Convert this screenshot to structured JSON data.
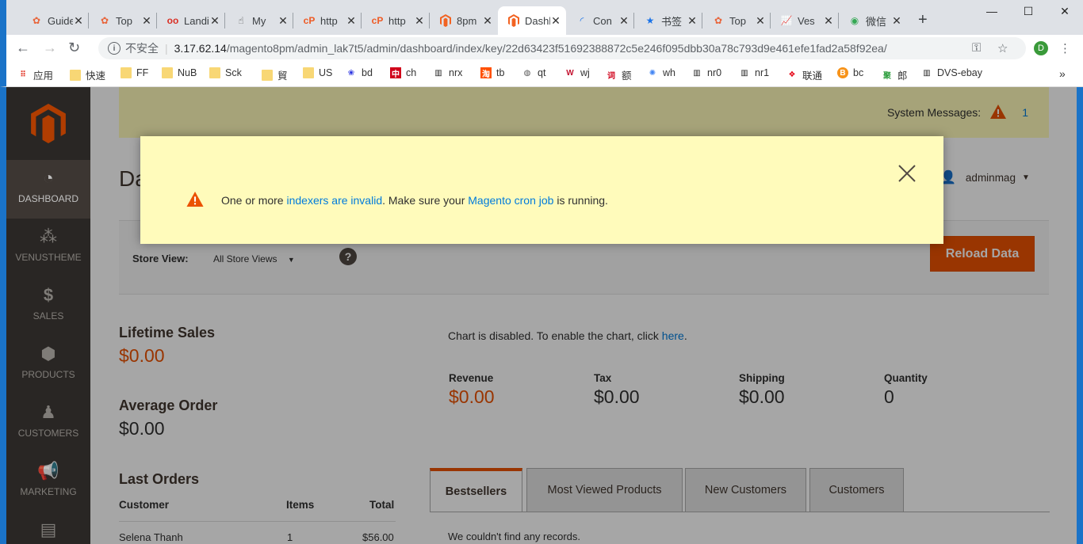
{
  "browser": {
    "tabs": [
      {
        "label": "Guide",
        "icon": "flower-icon",
        "color": "#e8643a"
      },
      {
        "label": "Top",
        "icon": "flower-icon",
        "color": "#e8643a"
      },
      {
        "label": "Landing",
        "icon": "goggles-icon",
        "color": "#d93025"
      },
      {
        "label": "My",
        "icon": "pointer-icon",
        "color": "#555555"
      },
      {
        "label": "http",
        "icon": "cp-icon",
        "color": "#ee5a24"
      },
      {
        "label": "http",
        "icon": "cp-icon",
        "color": "#ee5a24"
      },
      {
        "label": "8pm",
        "icon": "magento-icon",
        "color": "#f26322"
      },
      {
        "label": "Dashboard",
        "icon": "magento-icon",
        "color": "#f26322"
      },
      {
        "label": "Con",
        "icon": "loading-icon",
        "color": "#1a73e8"
      },
      {
        "label": "书签",
        "icon": "star-icon",
        "color": "#1a73e8"
      },
      {
        "label": "Top",
        "icon": "flower-icon",
        "color": "#e8643a"
      },
      {
        "label": "Ves",
        "icon": "chart-icon",
        "color": "#c0392b"
      },
      {
        "label": "微信",
        "icon": "chrome-icon",
        "color": "#34a853"
      }
    ],
    "new_tab": "+",
    "insecure_label": "不安全",
    "url_host": "3.17.62.14",
    "url_path": "/magento8pm/admin_lak7t5/admin/dashboard/index/key/22d63423f51692388872c5e246f095dbb30a78c793d9e461efe1fad2a58f92ea/",
    "profile_initial": "D",
    "bookmarks": [
      {
        "label": "应用",
        "icon": "apps-grid-icon",
        "color": "#e34133"
      },
      {
        "label": "快速",
        "icon": "folder-icon",
        "color": "#f8d775"
      },
      {
        "label": "FF",
        "icon": "folder-icon",
        "color": "#f8d775"
      },
      {
        "label": "NuB",
        "icon": "folder-icon",
        "color": "#f8d775"
      },
      {
        "label": "Sck",
        "icon": "folder-icon",
        "color": "#f8d775"
      },
      {
        "label": "貿",
        "icon": "folder-icon",
        "color": "#f8d775"
      },
      {
        "label": "US",
        "icon": "folder-icon",
        "color": "#f8d775"
      },
      {
        "label": "bd",
        "icon": "paw-icon",
        "color": "#2932e1"
      },
      {
        "label": "ch",
        "icon": "zhong-icon",
        "color": "#d0021b"
      },
      {
        "label": "nrx",
        "icon": "shop-icon",
        "color": "#222222"
      },
      {
        "label": "tb",
        "icon": "tao-icon",
        "color": "#ff5000"
      },
      {
        "label": "qt",
        "icon": "globe-icon",
        "color": "#555555"
      },
      {
        "label": "wj",
        "icon": "w-icon",
        "color": "#c41230"
      },
      {
        "label": "额",
        "icon": "ci-icon",
        "color": "#d0021b"
      },
      {
        "label": "wh",
        "icon": "pinwheel-icon",
        "color": "#4285f4"
      },
      {
        "label": "nr0",
        "icon": "shop-icon",
        "color": "#222222"
      },
      {
        "label": "nr1",
        "icon": "shop-icon",
        "color": "#222222"
      },
      {
        "label": "联通",
        "icon": "unicom-icon",
        "color": "#e60012"
      },
      {
        "label": "bc",
        "icon": "bitcoin-icon",
        "color": "#f7931a"
      },
      {
        "label": "郎",
        "icon": "ju-icon",
        "color": "#2e9e3f"
      },
      {
        "label": "DVS-ebay",
        "icon": "shop-icon",
        "color": "#222222"
      }
    ]
  },
  "menu": [
    {
      "label": "DASHBOARD",
      "icon": "gauge-icon",
      "active": true
    },
    {
      "label": "VENUSTHEME",
      "icon": "sparkle-icon"
    },
    {
      "label": "SALES",
      "icon": "dollar-icon"
    },
    {
      "label": "PRODUCTS",
      "icon": "box-icon"
    },
    {
      "label": "CUSTOMERS",
      "icon": "person-icon"
    },
    {
      "label": "MARKETING",
      "icon": "megaphone-icon"
    }
  ],
  "system_messages": {
    "label": "System Messages:",
    "count": "1"
  },
  "page_title": "Dashboard",
  "user": {
    "name": "adminmag"
  },
  "store_view": {
    "label": "Store View:",
    "value": "All Store Views"
  },
  "help_symbol": "?",
  "reload_label": "Reload Data",
  "lifetime_sales": {
    "label": "Lifetime Sales",
    "value": "$0.00"
  },
  "average_order": {
    "label": "Average Order",
    "value": "$0.00"
  },
  "chart_message": {
    "prefix": "Chart is disabled. To enable the chart, click ",
    "link": "here",
    "suffix": "."
  },
  "totals": [
    {
      "label": "Revenue",
      "value": "$0.00",
      "highlight": true
    },
    {
      "label": "Tax",
      "value": "$0.00"
    },
    {
      "label": "Shipping",
      "value": "$0.00"
    },
    {
      "label": "Quantity",
      "value": "0"
    }
  ],
  "last_orders": {
    "title": "Last Orders",
    "columns": [
      "Customer",
      "Items",
      "Total"
    ],
    "rows": [
      {
        "customer": "Selena Thanh",
        "items": "1",
        "total": "$56.00"
      }
    ]
  },
  "dashboard_tabs": [
    "Bestsellers",
    "Most Viewed Products",
    "New Customers",
    "Customers"
  ],
  "no_records": "We couldn't find any records.",
  "modal": {
    "part1": "One or more ",
    "link1": "indexers are invalid",
    "part2": ". Make sure your ",
    "link2": "Magento cron job",
    "part3": " is running."
  },
  "colors": {
    "accent": "#eb5202",
    "link": "#007bdb",
    "message_bg": "#fffbbb",
    "menu_bg": "#373330"
  }
}
